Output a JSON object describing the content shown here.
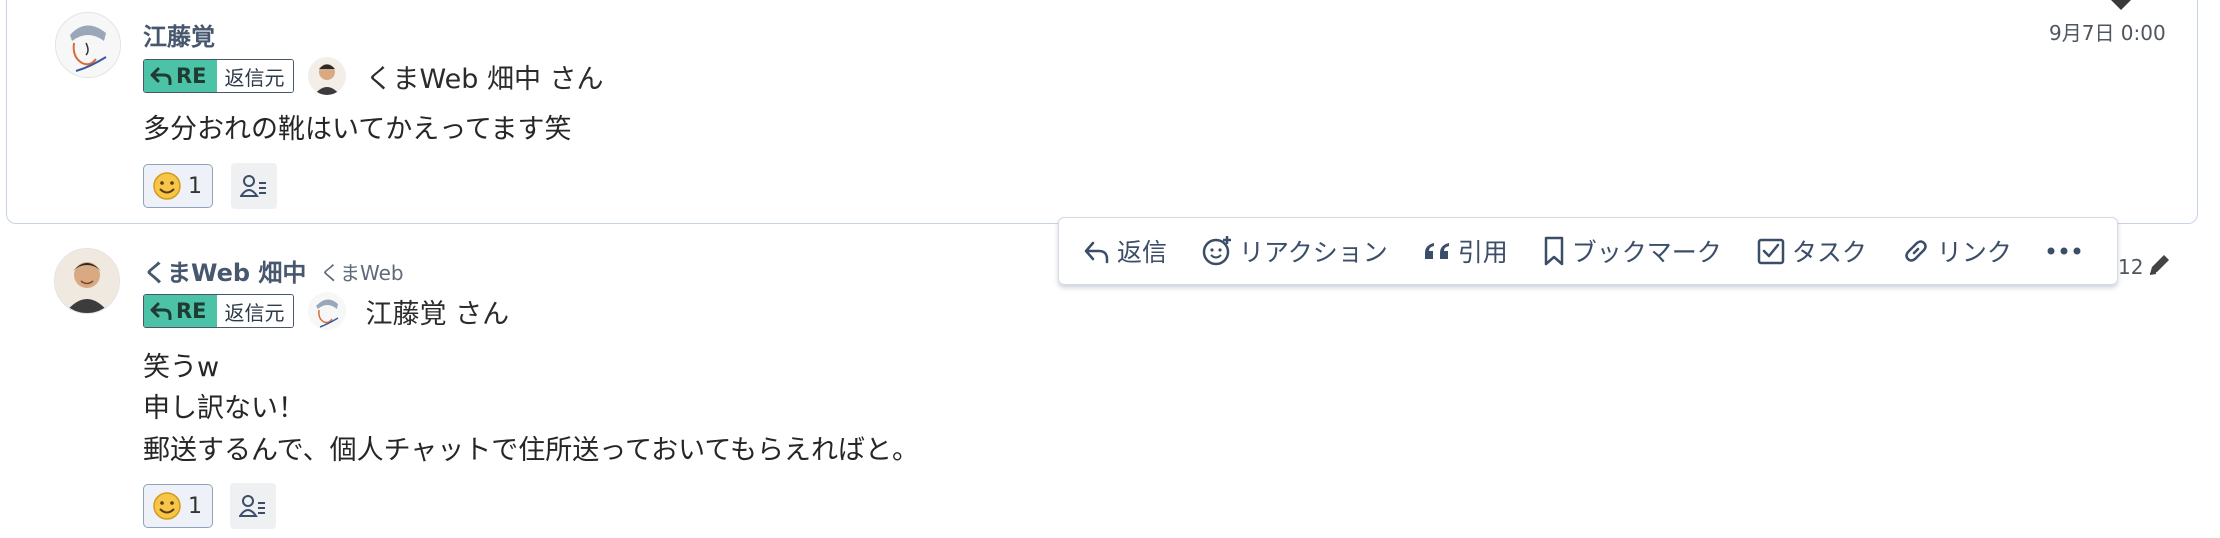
{
  "messages": [
    {
      "sender": "江藤覚",
      "time": "9月7日 0:00",
      "reply_badge": "RE",
      "reply_source": "返信元",
      "reply_to": "くまWeb 畑中 さん",
      "body": [
        "多分おれの靴はいてかえってます笑"
      ],
      "reaction_count": "1"
    },
    {
      "sender": "くまWeb 畑中",
      "org": "くまWeb",
      "time_fragment": "12",
      "reply_badge": "RE",
      "reply_source": "返信元",
      "reply_to": "江藤覚 さん",
      "body": [
        "笑うw",
        "申し訳ない！",
        "郵送するんで、個人チャットで住所送っておいてもらえればと。"
      ],
      "reaction_count": "1"
    }
  ],
  "toolbar": {
    "reply": "返信",
    "reaction": "リアクション",
    "quote": "引用",
    "bookmark": "ブックマーク",
    "task": "タスク",
    "link": "リンク",
    "more": "···"
  },
  "colors": {
    "accent_green": "#4cc3a6",
    "icon_blue": "#3b4d68",
    "border": "#c9d4e3"
  }
}
